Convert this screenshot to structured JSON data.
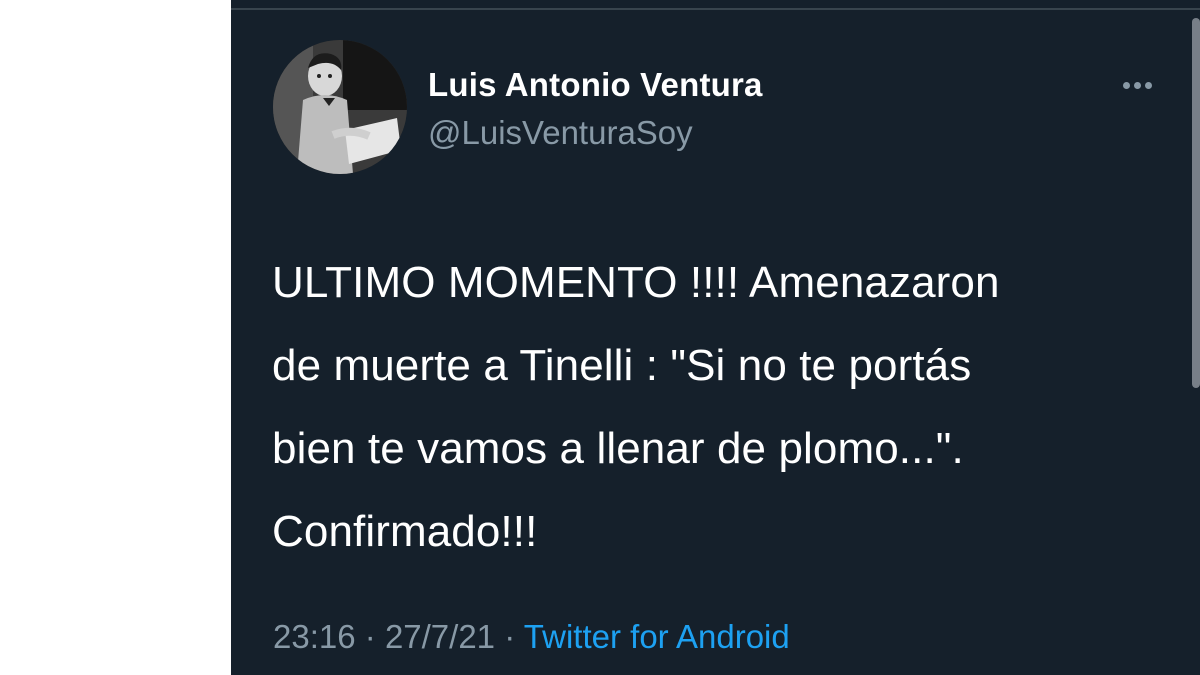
{
  "tweet": {
    "author": {
      "display_name": "Luis Antonio Ventura",
      "handle": "@LuisVenturaSoy",
      "avatar_icon": "profile-photo"
    },
    "menu_icon": "more-icon",
    "text": "ULTIMO MOMENTO !!!! Amenazaron\nde muerte a Tinelli : \"Si no te portás\nbien te vamos a llenar  de plomo...\".\nConfirmado!!!",
    "time": "23:16",
    "date": "27/7/21",
    "separator": "·",
    "source": "Twitter for Android"
  },
  "colors": {
    "background": "#15202b",
    "text_primary": "#ffffff",
    "text_secondary": "#8899a6",
    "link": "#1da1f2"
  }
}
